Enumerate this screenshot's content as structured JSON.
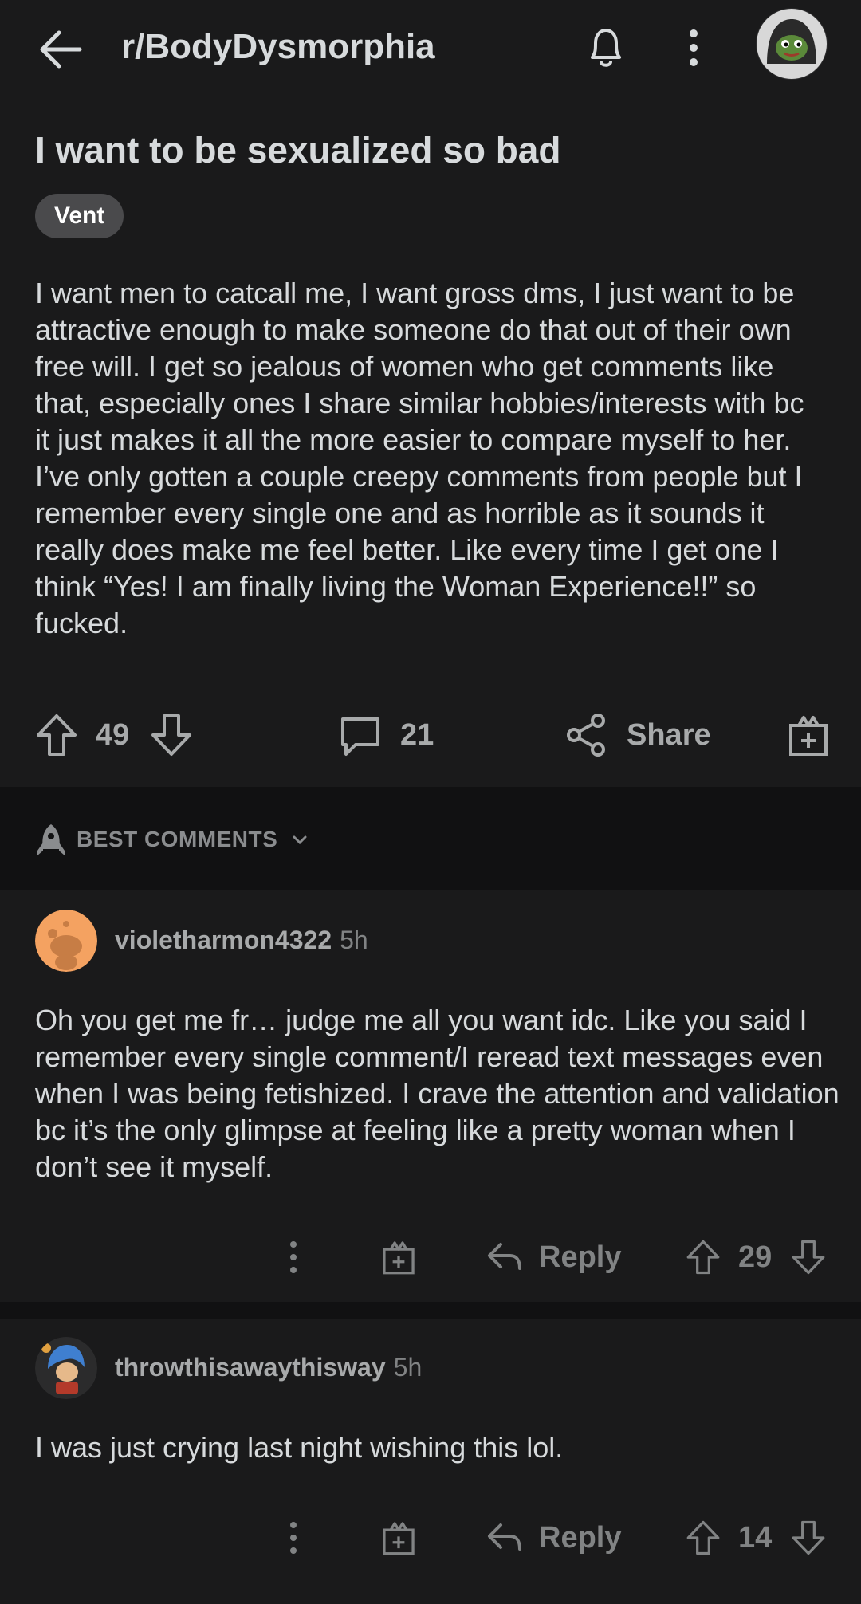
{
  "header": {
    "subreddit": "r/BodyDysmorphia"
  },
  "post": {
    "title": "I want to be sexualized so bad",
    "flair": "Vent",
    "body": "I want men to catcall me, I want gross dms, I just want to be attractive enough to make someone do that out of their own free will. I get so jealous of women who get comments like that, especially ones I share similar hobbies/interests with bc it just makes it all the more easier to compare myself to her.  I’ve only gotten a couple creepy comments from people but I remember every single one and as horrible as it sounds it really does make me feel better. Like every time I get one I think “Yes! I am finally living the Woman Experience!!” so fucked.",
    "votes": "49",
    "comments": "21",
    "share_label": "Share"
  },
  "sort": {
    "label": "BEST COMMENTS"
  },
  "comments": [
    {
      "username": "violetharmon4322",
      "time": "5h",
      "body": "Oh you get me fr… judge me all you want idc. Like you said I remember every single comment/I reread text messages even when I was being fetishized. I crave the attention and validation bc it’s the only glimpse at feeling like a pretty woman when I don’t see it myself.",
      "reply_label": "Reply",
      "votes": "29",
      "avatar_color": "#f4a261"
    },
    {
      "username": "throwthisawaythisway",
      "time": "5h",
      "body": "I was just crying last night wishing this lol.",
      "reply_label": "Reply",
      "votes": "14",
      "avatar_color": "#2b3a67"
    }
  ],
  "colors": {
    "background": "#1a1a1b",
    "divider": "#111112",
    "text": "#d7dadc",
    "muted": "#818384",
    "flair_bg": "#4a4a4c"
  }
}
